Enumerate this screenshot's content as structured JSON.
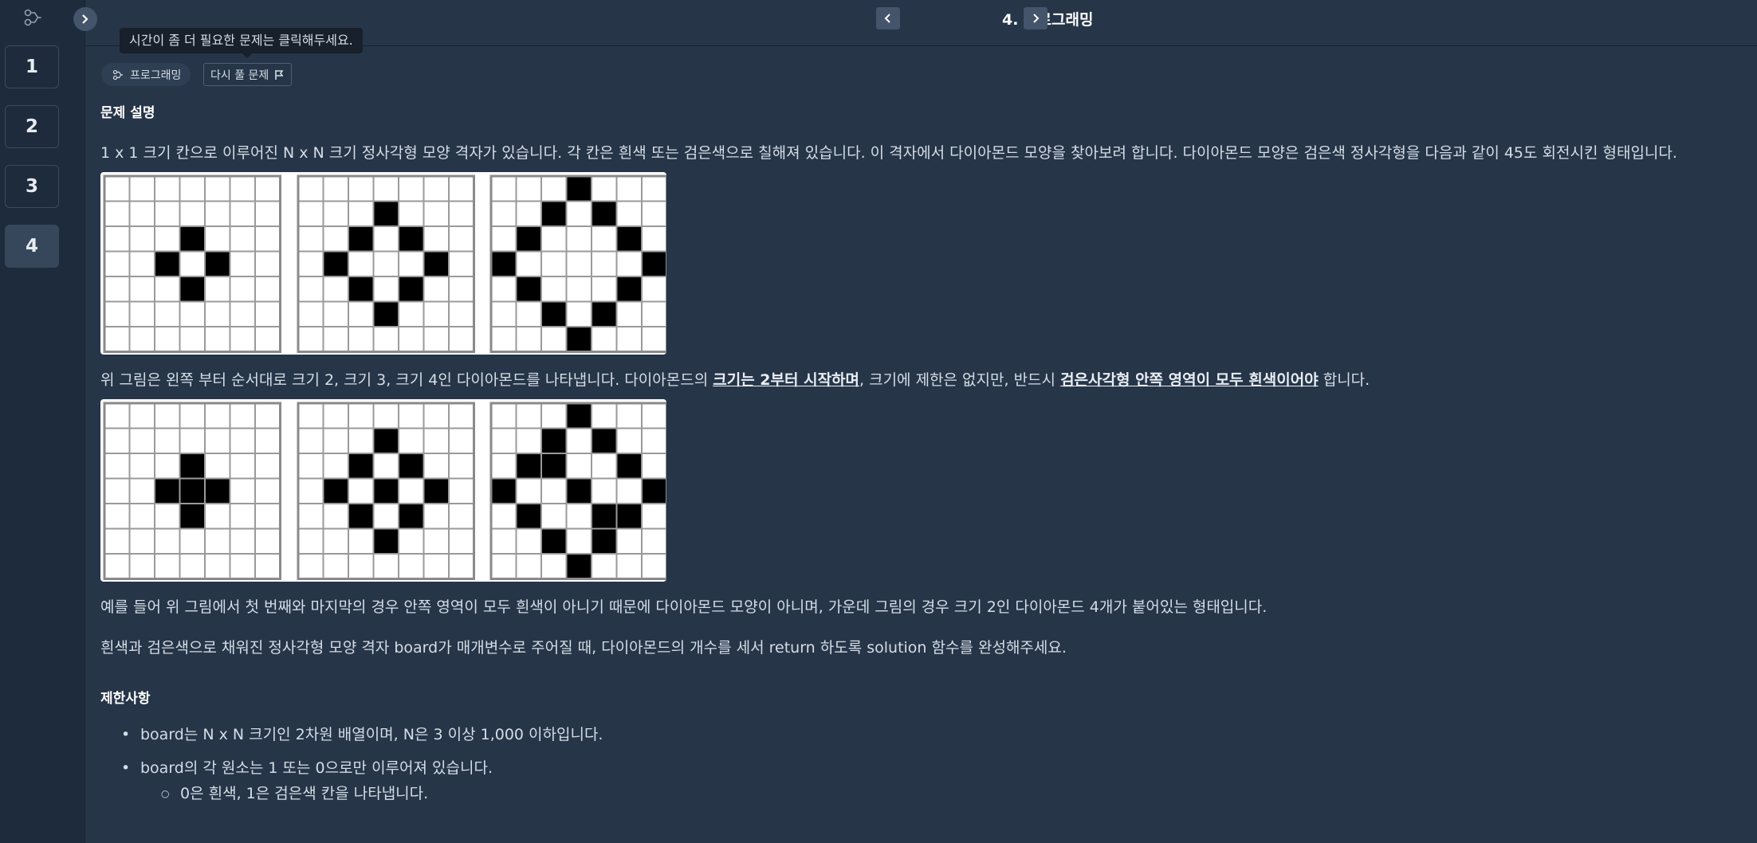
{
  "topbar": {
    "title": "4. 프로그래밍"
  },
  "sidebar": {
    "questions": [
      "1",
      "2",
      "3",
      "4"
    ],
    "active": "4"
  },
  "tooltip": "시간이 좀 더 필요한 문제는 클릭해두세요.",
  "chips": {
    "category": "프로그래밍",
    "retry": "다시 풀 문제"
  },
  "problem": {
    "heading": "문제 설명",
    "intro": "1 x 1 크기 칸으로 이루어진 N x N 크기 정사각형 모양 격자가 있습니다. 각 칸은 흰색 또는 검은색으로 칠해져 있습니다. 이 격자에서 다이아몬드 모양을 찾아보려 합니다. 다이아몬드 모양은 검은색 정사각형을 다음과 같이 45도 회전시킨 형태입니다.",
    "desc2_a": "위 그림은 왼쪽 부터 순서대로 크기 2, 크기 3, 크기 4인 다이아몬드를 나타냅니다. 다이아몬드의 ",
    "desc2_b": "크기는 2부터 시작하며",
    "desc2_c": ", 크기에 제한은 없지만, 반드시 ",
    "desc2_d": "검은사각형 안쪽 영역이 모두 흰색이어야",
    "desc2_e": " 합니다.",
    "desc3": "예를 들어 위 그림에서 첫 번째와 마지막의 경우 안쪽 영역이 모두 흰색이 아니기 때문에 다이아몬드 모양이 아니며, 가운데 그림의 경우 크기 2인 다이아몬드 4개가 붙어있는 형태입니다.",
    "desc4": "흰색과 검은색으로 채워진 정사각형 모양 격자 board가 매개변수로 주어질 때, 다이아몬드의 개수를 세서 return 하도록 solution 함수를 완성해주세요."
  },
  "constraints": {
    "heading": "제한사항",
    "items": [
      "board는 N x N 크기인 2차원 배열이며, N은 3 이상 1,000 이하입니다.",
      "board의 각 원소는 1 또는 0으로만 이루어져 있습니다."
    ],
    "subitems": [
      "0은 흰색, 1은 검은색 칸을 나타냅니다."
    ]
  },
  "figures": [
    [
      [
        [
          0,
          0,
          0,
          0,
          0,
          0,
          0
        ],
        [
          0,
          0,
          0,
          0,
          0,
          0,
          0
        ],
        [
          0,
          0,
          0,
          1,
          0,
          0,
          0
        ],
        [
          0,
          0,
          1,
          0,
          1,
          0,
          0
        ],
        [
          0,
          0,
          0,
          1,
          0,
          0,
          0
        ],
        [
          0,
          0,
          0,
          0,
          0,
          0,
          0
        ],
        [
          0,
          0,
          0,
          0,
          0,
          0,
          0
        ]
      ],
      [
        [
          0,
          0,
          0,
          0,
          0,
          0,
          0
        ],
        [
          0,
          0,
          0,
          1,
          0,
          0,
          0
        ],
        [
          0,
          0,
          1,
          0,
          1,
          0,
          0
        ],
        [
          0,
          1,
          0,
          0,
          0,
          1,
          0
        ],
        [
          0,
          0,
          1,
          0,
          1,
          0,
          0
        ],
        [
          0,
          0,
          0,
          1,
          0,
          0,
          0
        ],
        [
          0,
          0,
          0,
          0,
          0,
          0,
          0
        ]
      ],
      [
        [
          0,
          0,
          0,
          1,
          0,
          0,
          0
        ],
        [
          0,
          0,
          1,
          0,
          1,
          0,
          0
        ],
        [
          0,
          1,
          0,
          0,
          0,
          1,
          0
        ],
        [
          1,
          0,
          0,
          0,
          0,
          0,
          1
        ],
        [
          0,
          1,
          0,
          0,
          0,
          1,
          0
        ],
        [
          0,
          0,
          1,
          0,
          1,
          0,
          0
        ],
        [
          0,
          0,
          0,
          1,
          0,
          0,
          0
        ]
      ]
    ],
    [
      [
        [
          0,
          0,
          0,
          0,
          0,
          0,
          0
        ],
        [
          0,
          0,
          0,
          0,
          0,
          0,
          0
        ],
        [
          0,
          0,
          0,
          1,
          0,
          0,
          0
        ],
        [
          0,
          0,
          1,
          1,
          1,
          0,
          0
        ],
        [
          0,
          0,
          0,
          1,
          0,
          0,
          0
        ],
        [
          0,
          0,
          0,
          0,
          0,
          0,
          0
        ],
        [
          0,
          0,
          0,
          0,
          0,
          0,
          0
        ]
      ],
      [
        [
          0,
          0,
          0,
          0,
          0,
          0,
          0
        ],
        [
          0,
          0,
          0,
          1,
          0,
          0,
          0
        ],
        [
          0,
          0,
          1,
          0,
          1,
          0,
          0
        ],
        [
          0,
          1,
          0,
          1,
          0,
          1,
          0
        ],
        [
          0,
          0,
          1,
          0,
          1,
          0,
          0
        ],
        [
          0,
          0,
          0,
          1,
          0,
          0,
          0
        ],
        [
          0,
          0,
          0,
          0,
          0,
          0,
          0
        ]
      ],
      [
        [
          0,
          0,
          0,
          1,
          0,
          0,
          0
        ],
        [
          0,
          0,
          1,
          0,
          1,
          0,
          0
        ],
        [
          0,
          1,
          1,
          0,
          0,
          1,
          0
        ],
        [
          1,
          0,
          0,
          1,
          0,
          0,
          1
        ],
        [
          0,
          1,
          0,
          0,
          1,
          1,
          0
        ],
        [
          0,
          0,
          1,
          0,
          1,
          0,
          0
        ],
        [
          0,
          0,
          0,
          1,
          0,
          0,
          0
        ]
      ]
    ]
  ]
}
